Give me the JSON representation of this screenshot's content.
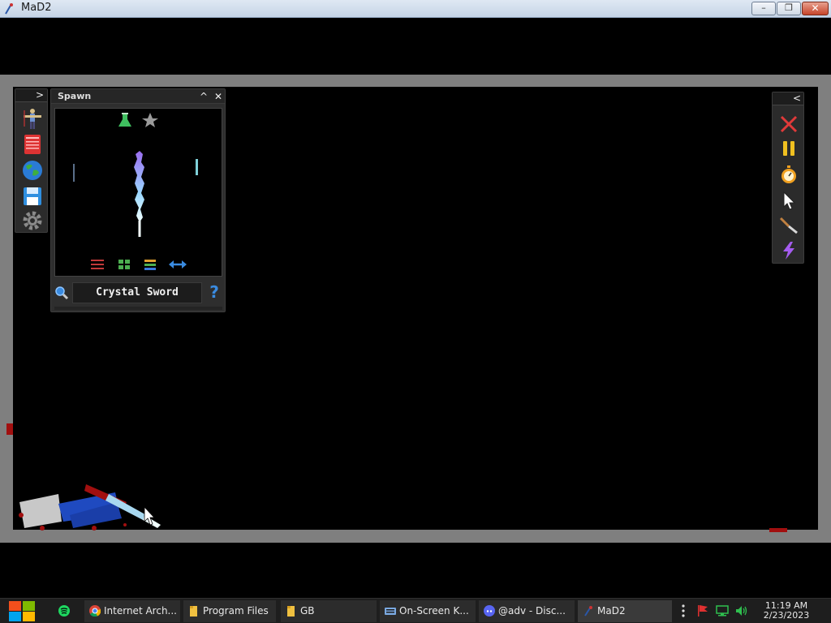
{
  "window": {
    "title": "MaD2",
    "minimize_label": "–",
    "maximize_label": "❐",
    "close_label": "✕"
  },
  "left_toolbar": {
    "collapse_label": ">",
    "tools": [
      {
        "icon": "ragdoll-icon"
      },
      {
        "icon": "book-icon"
      },
      {
        "icon": "globe-icon"
      },
      {
        "icon": "save-icon"
      },
      {
        "icon": "gear-icon"
      }
    ]
  },
  "spawn_panel": {
    "title": "Spawn",
    "minimize_label": "^",
    "close_label": "✕",
    "selected_item": "Crystal Sword",
    "help_label": "?",
    "top_icons": [
      "flask-icon",
      "star-icon"
    ],
    "bottom_icons": [
      "sliders-icon",
      "grid-icon",
      "list-icon",
      "swap-arrows-icon"
    ]
  },
  "right_toolbar": {
    "collapse_label": "<",
    "tools": [
      "delete-x-icon",
      "pause-icon",
      "stopwatch-icon",
      "cursor-icon",
      "knife-icon",
      "lightning-icon"
    ]
  },
  "taskbar": {
    "items": [
      {
        "label": "Internet Arch...",
        "icon": "chrome-icon"
      },
      {
        "label": "Program Files",
        "icon": "folder-icon"
      },
      {
        "label": "GB",
        "icon": "folder-icon"
      },
      {
        "label": "On-Screen K...",
        "icon": "keyboard-icon"
      },
      {
        "label": "@adv - Disc...",
        "icon": "discord-icon"
      },
      {
        "label": "MaD2",
        "icon": "mad2-icon"
      }
    ],
    "time": "11:19 AM",
    "date": "2/23/2023"
  },
  "colors": {
    "arena_bg": "#000000",
    "frame": "#7f7f7f",
    "panel": "#2e2e2e",
    "sword_top": "#9a6cf0",
    "sword_bottom": "#e8ffff",
    "blood": "#a10f0f"
  }
}
